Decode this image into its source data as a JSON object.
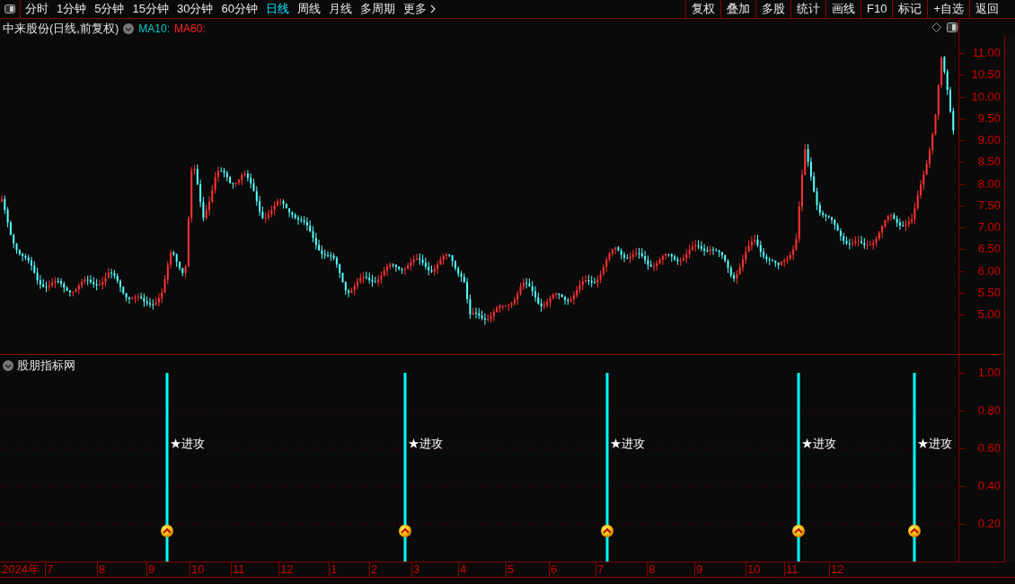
{
  "periods": [
    {
      "label": "分时",
      "selected": false
    },
    {
      "label": "1分钟",
      "selected": false
    },
    {
      "label": "5分钟",
      "selected": false
    },
    {
      "label": "15分钟",
      "selected": false
    },
    {
      "label": "30分钟",
      "selected": false
    },
    {
      "label": "60分钟",
      "selected": false
    },
    {
      "label": "日线",
      "selected": true
    },
    {
      "label": "周线",
      "selected": false
    },
    {
      "label": "月线",
      "selected": false
    },
    {
      "label": "多周期",
      "selected": false
    },
    {
      "label": "更多",
      "selected": false
    }
  ],
  "actions": [
    "复权",
    "叠加",
    "多股",
    "统计",
    "画线",
    "F10",
    "标记",
    "+自选",
    "返回"
  ],
  "main_chart": {
    "title": "中来股份(日线,前复权)",
    "ma": [
      {
        "label": "MA10:",
        "color": "#00c8c8"
      },
      {
        "label": "MA60:",
        "color": "#ff2020"
      }
    ],
    "price_ticks": [
      "11.00",
      "10.50",
      "10.00",
      "9.50",
      "9.00",
      "8.50",
      "8.00",
      "7.50",
      "7.00",
      "6.50",
      "6.00",
      "5.50",
      "5.00"
    ]
  },
  "indicator": {
    "title": "股朋指标网",
    "ticks": [
      "1.00",
      "0.80",
      "0.60",
      "0.40",
      "0.20"
    ],
    "signals": [
      {
        "label": "★进攻"
      },
      {
        "label": "★进攻"
      },
      {
        "label": "★进攻"
      },
      {
        "label": "★进攻"
      },
      {
        "label": "★进攻"
      }
    ]
  },
  "time_axis": [
    "2024年",
    "7",
    "8",
    "9",
    "10",
    "11",
    "12",
    "1",
    "2",
    "3",
    "4",
    "5",
    "6",
    "7",
    "8",
    "9",
    "10",
    "11",
    "12"
  ]
}
